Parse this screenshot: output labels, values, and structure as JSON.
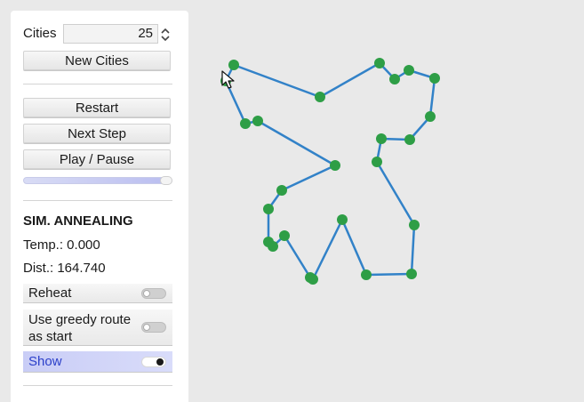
{
  "controls": {
    "cities_label": "Cities",
    "cities_value": "25",
    "new_cities_label": "New Cities",
    "restart_label": "Restart",
    "next_step_label": "Next Step",
    "play_pause_label": "Play / Pause",
    "speed_level": 0.95
  },
  "algorithm": {
    "title": "SIM. ANNEALING",
    "temp_text": "Temp.: 0.000",
    "dist_text": "Dist.: 164.740"
  },
  "toggles": [
    {
      "label": "Reheat",
      "on": false
    },
    {
      "label_line1": "Use greedy route",
      "label_line2": "as start",
      "on": false
    },
    {
      "label": "Show",
      "on": true
    }
  ],
  "colors": {
    "route": "#3282c8",
    "city": "#2e9e46",
    "panel": "#ffffff",
    "background": "#e9e9e9"
  }
}
